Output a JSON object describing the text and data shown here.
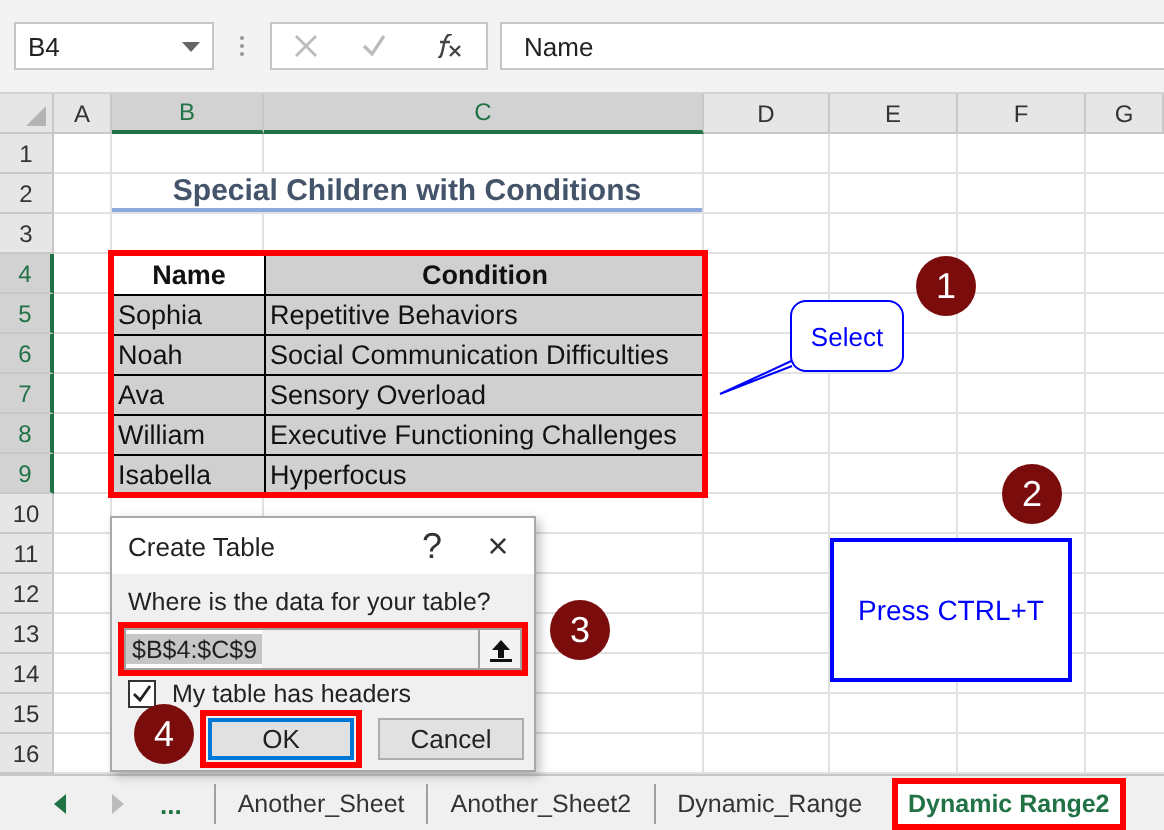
{
  "formula_bar": {
    "name_box": "B4",
    "formula": "Name"
  },
  "columns": [
    {
      "label": "A",
      "selected": false
    },
    {
      "label": "B",
      "selected": true
    },
    {
      "label": "C",
      "selected": true
    },
    {
      "label": "D",
      "selected": false
    },
    {
      "label": "E",
      "selected": false
    },
    {
      "label": "F",
      "selected": false
    },
    {
      "label": "G",
      "selected": false
    }
  ],
  "row_headers": [
    {
      "label": "1",
      "selected": false
    },
    {
      "label": "2",
      "selected": false
    },
    {
      "label": "3",
      "selected": false
    },
    {
      "label": "4",
      "selected": true
    },
    {
      "label": "5",
      "selected": true
    },
    {
      "label": "6",
      "selected": true
    },
    {
      "label": "7",
      "selected": true
    },
    {
      "label": "8",
      "selected": true
    },
    {
      "label": "9",
      "selected": true
    },
    {
      "label": "10",
      "selected": false
    },
    {
      "label": "11",
      "selected": false
    },
    {
      "label": "12",
      "selected": false
    },
    {
      "label": "13",
      "selected": false
    },
    {
      "label": "14",
      "selected": false
    },
    {
      "label": "15",
      "selected": false
    },
    {
      "label": "16",
      "selected": false
    }
  ],
  "sheet_title": "Special Children with Conditions",
  "table": {
    "highlighted": true,
    "header": [
      {
        "text": "Name",
        "active": true
      },
      {
        "text": "Condition",
        "active": false
      }
    ],
    "rows": [
      [
        "Sophia",
        "Repetitive Behaviors"
      ],
      [
        "Noah",
        "Social Communication Difficulties"
      ],
      [
        "Ava",
        "Sensory Overload"
      ],
      [
        "William",
        "Executive Functioning Challenges"
      ],
      [
        "Isabella",
        "Hyperfocus"
      ]
    ]
  },
  "callouts": [
    {
      "kind": "bubble",
      "text": "Select"
    },
    {
      "kind": "box",
      "text": "Press CTRL+T"
    }
  ],
  "steps": [
    "1",
    "2",
    "3",
    "4"
  ],
  "dialog": {
    "title": "Create Table",
    "help": "?",
    "close": "×",
    "prompt": "Where is the data for your table?",
    "range": {
      "value": "$B$4:$C$9",
      "highlighted": true
    },
    "headers_checkbox": {
      "label": "My table has headers",
      "checked": true
    },
    "buttons": [
      {
        "label": "OK",
        "highlighted": true
      },
      {
        "label": "Cancel",
        "highlighted": false
      }
    ]
  },
  "sheet_tabs": {
    "more": "...",
    "tabs": [
      {
        "label": "Another_Sheet",
        "selected": false
      },
      {
        "label": "Another_Sheet2",
        "selected": false
      },
      {
        "label": "Dynamic_Range",
        "selected": false
      },
      {
        "label": "Dynamic Range2",
        "selected": true
      }
    ]
  }
}
